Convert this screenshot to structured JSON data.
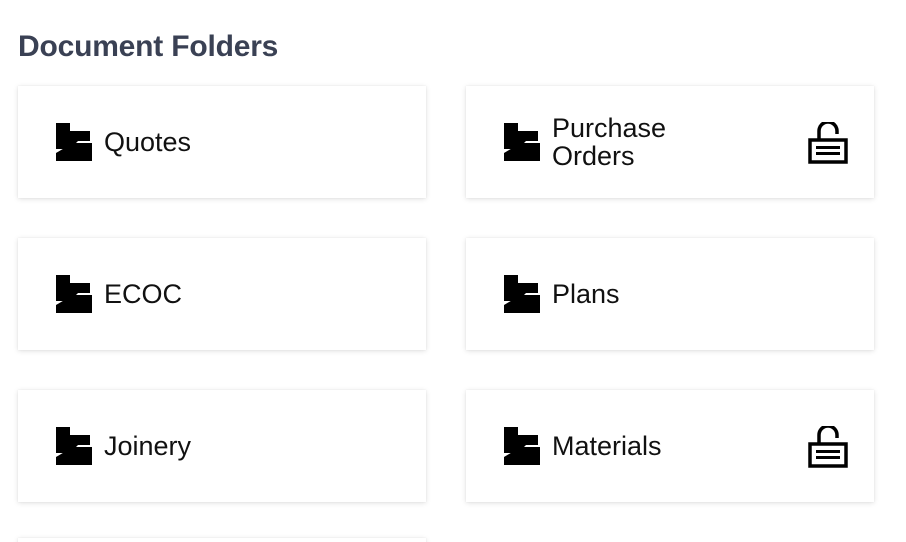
{
  "page": {
    "title": "Document Folders"
  },
  "folders": [
    {
      "label": "Quotes",
      "icon": "folder-icon",
      "locked": false
    },
    {
      "label": "Purchase Orders",
      "icon": "folder-icon",
      "locked": true
    },
    {
      "label": "ECOC",
      "icon": "folder-icon",
      "locked": false
    },
    {
      "label": "Plans",
      "icon": "folder-icon",
      "locked": false
    },
    {
      "label": "Joinery",
      "icon": "folder-icon",
      "locked": false
    },
    {
      "label": "Materials",
      "icon": "folder-icon",
      "locked": true
    }
  ],
  "colors": {
    "title": "#3a4154",
    "label": "#111111",
    "icon": "#000000"
  }
}
